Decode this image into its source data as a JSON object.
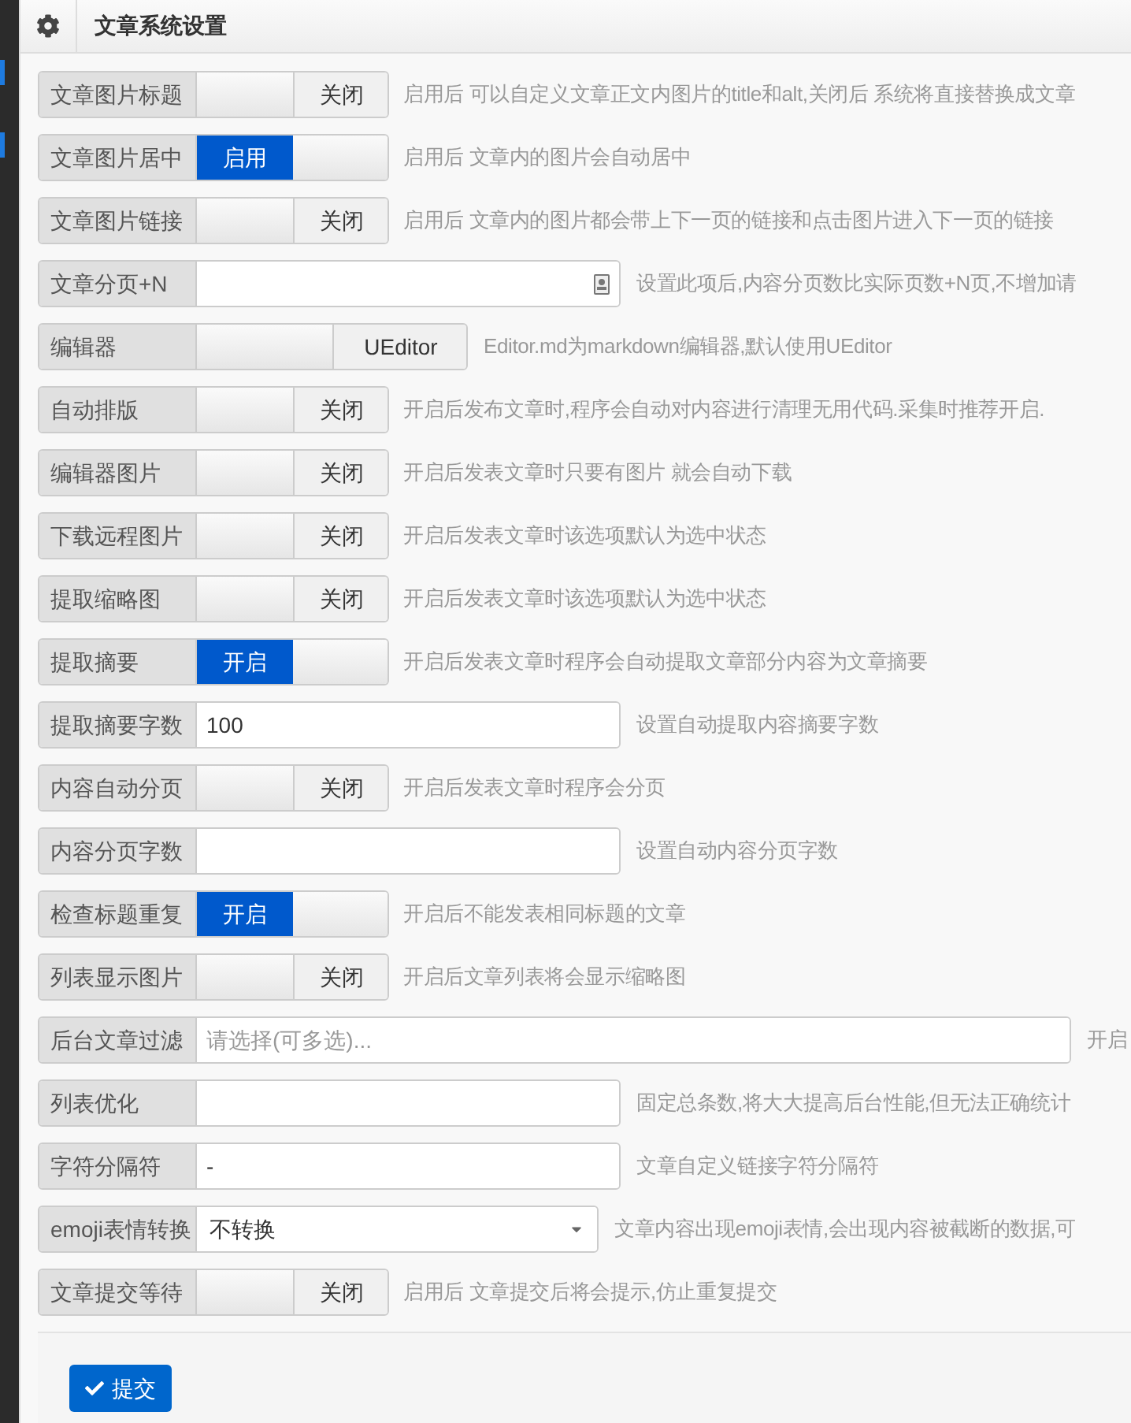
{
  "header": {
    "title": "文章系统设置"
  },
  "rows": [
    {
      "kind": "toggle",
      "label": "文章图片标题",
      "on": false,
      "switch_text": "关闭",
      "hint": "启用后 可以自定义文章正文内图片的title和alt,关闭后 系统将直接替换成文章"
    },
    {
      "kind": "toggle",
      "label": "文章图片居中",
      "on": true,
      "switch_text": "启用",
      "hint": "启用后 文章内的图片会自动居中"
    },
    {
      "kind": "toggle",
      "label": "文章图片链接",
      "on": false,
      "switch_text": "关闭",
      "hint": "启用后 文章内的图片都会带上下一页的链接和点击图片进入下一页的链接"
    },
    {
      "kind": "input",
      "label": "文章分页+N",
      "value": "",
      "icon": true,
      "hint": "设置此项后,内容分页数比实际页数+N页,不增加请"
    },
    {
      "kind": "editor",
      "label": "编辑器",
      "on": false,
      "switch_text": "UEditor",
      "hint": "Editor.md为markdown编辑器,默认使用UEditor"
    },
    {
      "kind": "toggle",
      "label": "自动排版",
      "on": false,
      "switch_text": "关闭",
      "hint": "开启后发布文章时,程序会自动对内容进行清理无用代码.采集时推荐开启."
    },
    {
      "kind": "toggle",
      "label": "编辑器图片",
      "on": false,
      "switch_text": "关闭",
      "hint": "开启后发表文章时只要有图片 就会自动下载"
    },
    {
      "kind": "toggle",
      "label": "下载远程图片",
      "on": false,
      "switch_text": "关闭",
      "hint": "开启后发表文章时该选项默认为选中状态"
    },
    {
      "kind": "toggle",
      "label": "提取缩略图",
      "on": false,
      "switch_text": "关闭",
      "hint": "开启后发表文章时该选项默认为选中状态"
    },
    {
      "kind": "toggle",
      "label": "提取摘要",
      "on": true,
      "switch_text": "开启",
      "hint": "开启后发表文章时程序会自动提取文章部分内容为文章摘要"
    },
    {
      "kind": "input",
      "label": "提取摘要字数",
      "value": "100",
      "hint": "设置自动提取内容摘要字数"
    },
    {
      "kind": "toggle",
      "label": "内容自动分页",
      "on": false,
      "switch_text": "关闭",
      "hint": "开启后发表文章时程序会分页"
    },
    {
      "kind": "input",
      "label": "内容分页字数",
      "value": "",
      "hint": "设置自动内容分页字数"
    },
    {
      "kind": "toggle",
      "label": "检查标题重复",
      "on": true,
      "switch_text": "开启",
      "hint": "开启后不能发表相同标题的文章"
    },
    {
      "kind": "toggle",
      "label": "列表显示图片",
      "on": false,
      "switch_text": "关闭",
      "hint": "开启后文章列表将会显示缩略图"
    },
    {
      "kind": "wide-input",
      "label": "后台文章过滤",
      "placeholder": "请选择(可多选)...",
      "hint": "开启"
    },
    {
      "kind": "input",
      "label": "列表优化",
      "value": "",
      "hint": "固定总条数,将大大提高后台性能,但无法正确统计"
    },
    {
      "kind": "input",
      "label": "字符分隔符",
      "value": "-",
      "hint": "文章自定义链接字符分隔符"
    },
    {
      "kind": "select",
      "label": "emoji表情转换",
      "value": "不转换",
      "hint": "文章内容出现emoji表情,会出现内容被截断的数据,可"
    },
    {
      "kind": "toggle",
      "label": "文章提交等待",
      "on": false,
      "switch_text": "关闭",
      "hint": "启用后 文章提交后将会提示,仿止重复提交"
    }
  ],
  "submit": {
    "label": "提交"
  }
}
